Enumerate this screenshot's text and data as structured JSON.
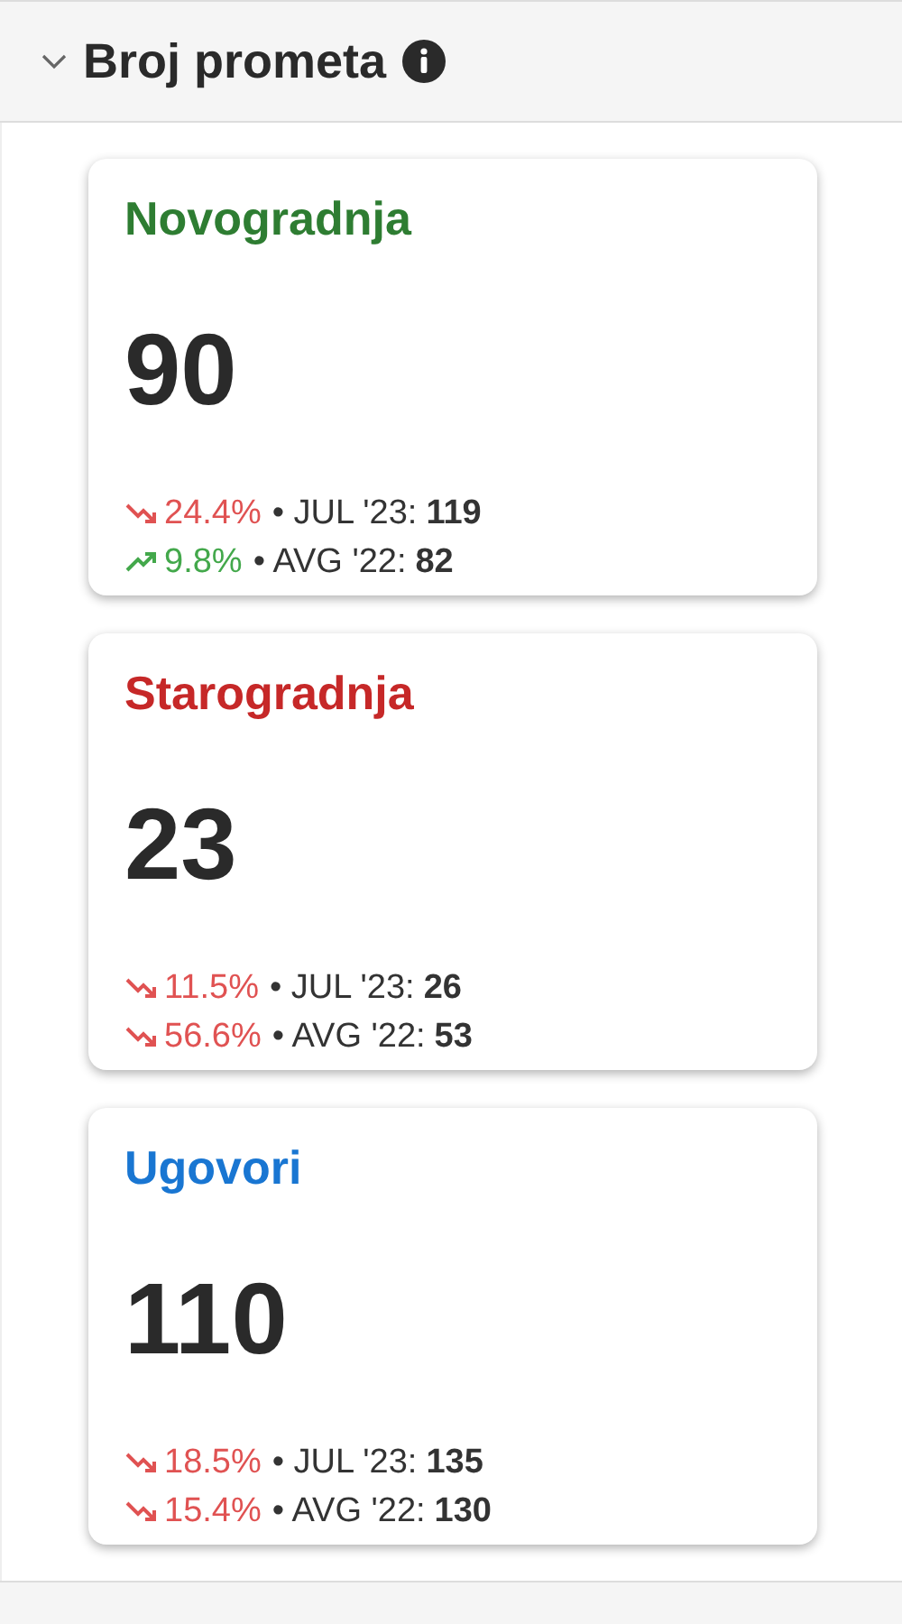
{
  "section": {
    "title": "Broj prometa",
    "expanded": true
  },
  "cards": [
    {
      "title": "Novogradnja",
      "color": "#2e7d32",
      "value": "90",
      "stats": [
        {
          "kind": "down",
          "change": "24.4%",
          "label": "• JUL '23:",
          "value": "119"
        },
        {
          "kind": "up",
          "change": "9.8%",
          "label": "• AVG '22:",
          "value": "82"
        }
      ]
    },
    {
      "title": "Starogradnja",
      "color": "#c62828",
      "value": "23",
      "stats": [
        {
          "kind": "down",
          "change": "11.5%",
          "label": "• JUL '23:",
          "value": "26"
        },
        {
          "kind": "down",
          "change": "56.6%",
          "label": "• AVG '22:",
          "value": "53"
        }
      ]
    },
    {
      "title": "Ugovori",
      "color": "#1976d2",
      "value": "110",
      "stats": [
        {
          "kind": "down",
          "change": "18.5%",
          "label": "• JUL '23:",
          "value": "135"
        },
        {
          "kind": "down",
          "change": "15.4%",
          "label": "• AVG '22:",
          "value": "130"
        }
      ]
    }
  ]
}
